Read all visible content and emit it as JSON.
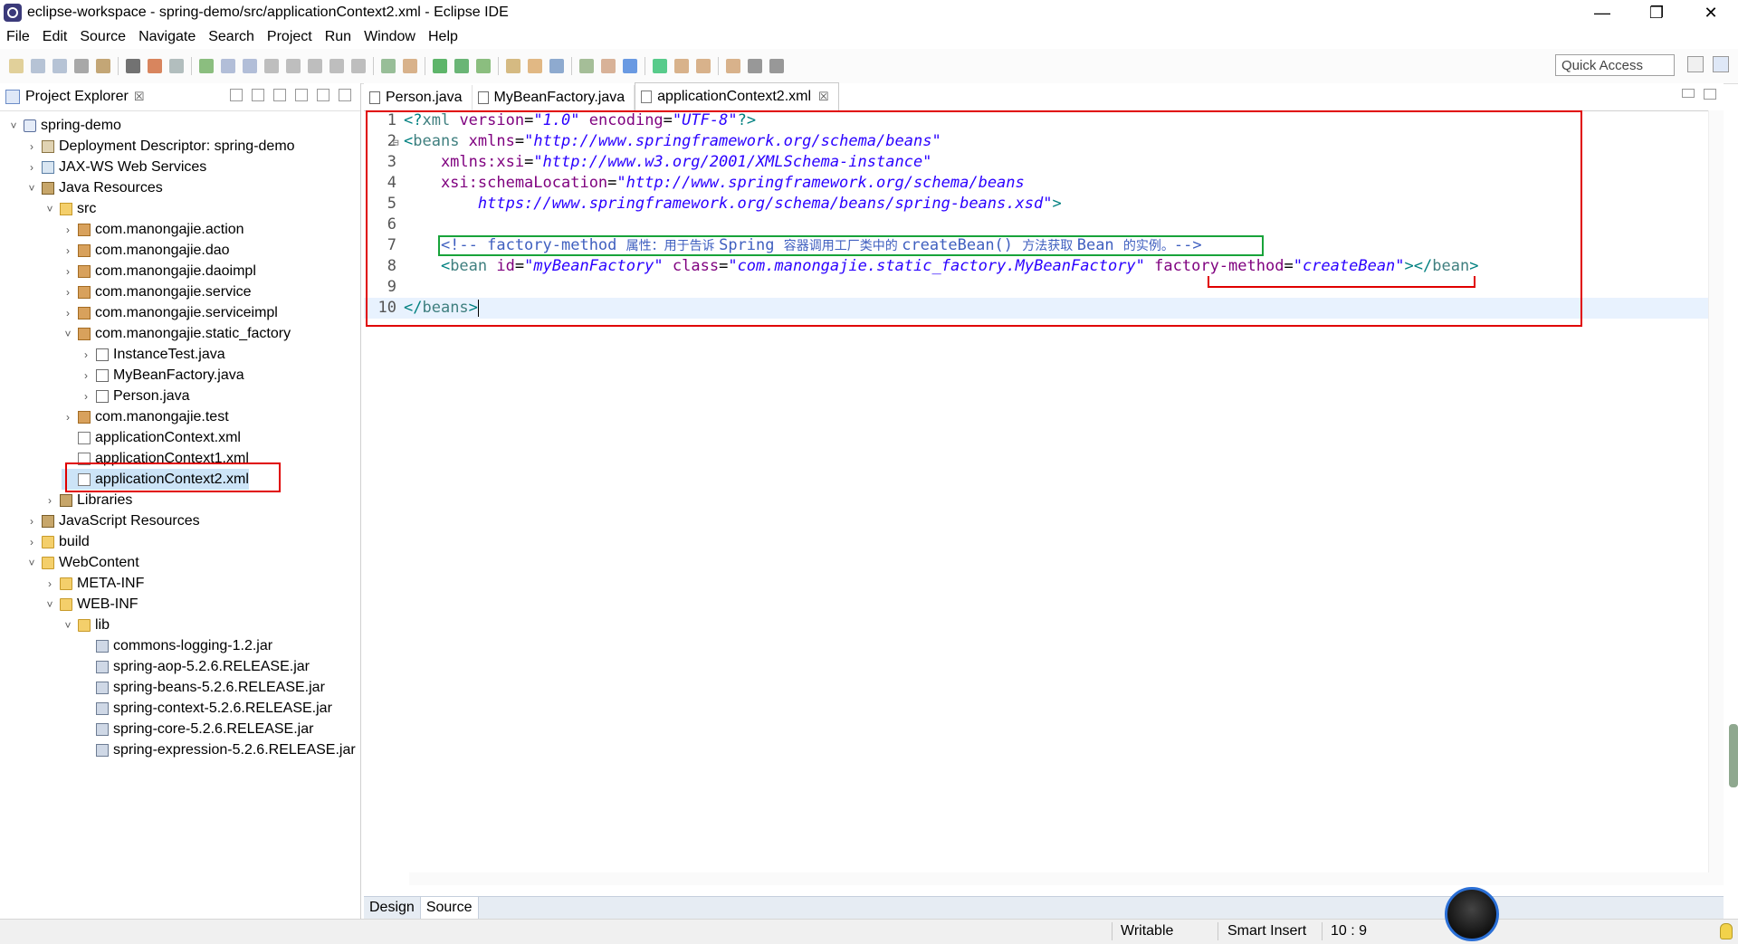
{
  "window": {
    "title": "eclipse-workspace - spring-demo/src/applicationContext2.xml - Eclipse IDE",
    "controls": [
      "—",
      "❐",
      "✕"
    ]
  },
  "menu": [
    "File",
    "Edit",
    "Source",
    "Navigate",
    "Search",
    "Project",
    "Run",
    "Window",
    "Help"
  ],
  "toolbar": {
    "quick_access_placeholder": "Quick Access"
  },
  "explorer": {
    "title": "Project Explorer",
    "close": "☒",
    "items": [
      {
        "label": "spring-demo",
        "arrow": "˅",
        "icon": "project-icon"
      },
      {
        "label": "Deployment Descriptor: spring-demo",
        "arrow": "›",
        "icon": "deployment-descriptor-icon"
      },
      {
        "label": "JAX-WS Web Services",
        "arrow": "›",
        "icon": "web-services-icon"
      },
      {
        "label": "Java Resources",
        "arrow": "˅",
        "icon": "java-resources-icon"
      },
      {
        "label": "src",
        "arrow": "˅",
        "icon": "source-folder-icon"
      },
      {
        "label": "com.manongajie.action",
        "arrow": "›",
        "icon": "package-icon"
      },
      {
        "label": "com.manongajie.dao",
        "arrow": "›",
        "icon": "package-icon"
      },
      {
        "label": "com.manongajie.daoimpl",
        "arrow": "›",
        "icon": "package-icon"
      },
      {
        "label": "com.manongajie.service",
        "arrow": "›",
        "icon": "package-icon"
      },
      {
        "label": "com.manongajie.serviceimpl",
        "arrow": "›",
        "icon": "package-icon"
      },
      {
        "label": "com.manongajie.static_factory",
        "arrow": "˅",
        "icon": "package-icon"
      },
      {
        "label": "InstanceTest.java",
        "arrow": "›",
        "icon": "java-file-icon"
      },
      {
        "label": "MyBeanFactory.java",
        "arrow": "›",
        "icon": "java-file-icon"
      },
      {
        "label": "Person.java",
        "arrow": "›",
        "icon": "java-file-icon"
      },
      {
        "label": "com.manongajie.test",
        "arrow": "›",
        "icon": "package-icon"
      },
      {
        "label": "applicationContext.xml",
        "arrow": "",
        "icon": "xml-file-icon"
      },
      {
        "label": "applicationContext1.xml",
        "arrow": "",
        "icon": "xml-file-icon"
      },
      {
        "label": "applicationContext2.xml",
        "arrow": "",
        "icon": "xml-file-icon"
      },
      {
        "label": "Libraries",
        "arrow": "›",
        "icon": "libraries-icon"
      },
      {
        "label": "JavaScript Resources",
        "arrow": "›",
        "icon": "javascript-resources-icon"
      },
      {
        "label": "build",
        "arrow": "›",
        "icon": "folder-icon"
      },
      {
        "label": "WebContent",
        "arrow": "˅",
        "icon": "folder-icon"
      },
      {
        "label": "META-INF",
        "arrow": "›",
        "icon": "folder-icon"
      },
      {
        "label": "WEB-INF",
        "arrow": "˅",
        "icon": "folder-icon"
      },
      {
        "label": "lib",
        "arrow": "˅",
        "icon": "folder-icon"
      },
      {
        "label": "commons-logging-1.2.jar",
        "arrow": "",
        "icon": "jar-icon"
      },
      {
        "label": "spring-aop-5.2.6.RELEASE.jar",
        "arrow": "",
        "icon": "jar-icon"
      },
      {
        "label": "spring-beans-5.2.6.RELEASE.jar",
        "arrow": "",
        "icon": "jar-icon"
      },
      {
        "label": "spring-context-5.2.6.RELEASE.jar",
        "arrow": "",
        "icon": "jar-icon"
      },
      {
        "label": "spring-core-5.2.6.RELEASE.jar",
        "arrow": "",
        "icon": "jar-icon"
      },
      {
        "label": "spring-expression-5.2.6.RELEASE.jar",
        "arrow": "",
        "icon": "jar-icon"
      }
    ]
  },
  "editor": {
    "tabs": [
      {
        "label": "Person.java",
        "icon": "java-file-icon"
      },
      {
        "label": "MyBeanFactory.java",
        "icon": "java-file-icon"
      },
      {
        "label": "applicationContext2.xml",
        "icon": "xml-file-icon",
        "close": "☒"
      }
    ],
    "lines": [
      {
        "num": "1",
        "marker": "",
        "tokens": [
          {
            "t": "<?",
            "c": "t-punct"
          },
          {
            "t": "xml ",
            "c": "t-tag"
          },
          {
            "t": "version",
            "c": "t-attr"
          },
          {
            "t": "=",
            "c": ""
          },
          {
            "t": "\"1.0\"",
            "c": "t-val"
          },
          {
            "t": " ",
            "c": ""
          },
          {
            "t": "encoding",
            "c": "t-attr"
          },
          {
            "t": "=",
            "c": ""
          },
          {
            "t": "\"UTF-8\"",
            "c": "t-val"
          },
          {
            "t": "?>",
            "c": "t-punct"
          }
        ]
      },
      {
        "num": "2",
        "marker": "⊟",
        "tokens": [
          {
            "t": "<",
            "c": "t-punct"
          },
          {
            "t": "beans ",
            "c": "t-tag"
          },
          {
            "t": "xmlns",
            "c": "t-attr"
          },
          {
            "t": "=",
            "c": ""
          },
          {
            "t": "\"http://www.springframework.org/schema/beans\"",
            "c": "t-val"
          }
        ]
      },
      {
        "num": "3",
        "marker": "",
        "tokens": [
          {
            "t": "    xmlns:xsi",
            "c": "t-attr"
          },
          {
            "t": "=",
            "c": ""
          },
          {
            "t": "\"http://www.w3.org/2001/XMLSchema-instance\"",
            "c": "t-val"
          }
        ]
      },
      {
        "num": "4",
        "marker": "",
        "tokens": [
          {
            "t": "    xsi:schemaLocation",
            "c": "t-attr"
          },
          {
            "t": "=",
            "c": ""
          },
          {
            "t": "\"http://www.springframework.org/schema/beans",
            "c": "t-val"
          }
        ]
      },
      {
        "num": "5",
        "marker": "",
        "tokens": [
          {
            "t": "        https://www.springframework.org/schema/beans/spring-beans.xsd\"",
            "c": "t-val"
          },
          {
            "t": ">",
            "c": "t-punct"
          }
        ]
      },
      {
        "num": "6",
        "marker": "",
        "tokens": []
      },
      {
        "num": "7",
        "marker": "",
        "tokens": [
          {
            "t": "    <!-- factory-method ",
            "c": "t-comment"
          },
          {
            "t": "属性：用于告诉 ",
            "c": "t-comment zh"
          },
          {
            "t": "Spring ",
            "c": "t-comment"
          },
          {
            "t": "容器调用工厂类中的 ",
            "c": "t-comment zh"
          },
          {
            "t": "createBean() ",
            "c": "t-comment"
          },
          {
            "t": "方法获取 ",
            "c": "t-comment zh"
          },
          {
            "t": "Bean ",
            "c": "t-comment"
          },
          {
            "t": "的实例。",
            "c": "t-comment zh"
          },
          {
            "t": "-->",
            "c": "t-comment"
          }
        ]
      },
      {
        "num": "8",
        "marker": "",
        "tokens": [
          {
            "t": "    <",
            "c": "t-punct"
          },
          {
            "t": "bean ",
            "c": "t-tag"
          },
          {
            "t": "id",
            "c": "t-attr"
          },
          {
            "t": "=",
            "c": ""
          },
          {
            "t": "\"myBeanFactory\"",
            "c": "t-val"
          },
          {
            "t": " ",
            "c": ""
          },
          {
            "t": "class",
            "c": "t-attr"
          },
          {
            "t": "=",
            "c": ""
          },
          {
            "t": "\"com.manongajie.static_factory.MyBeanFactory\"",
            "c": "t-val"
          },
          {
            "t": " ",
            "c": ""
          },
          {
            "t": "factory-method",
            "c": "t-attr"
          },
          {
            "t": "=",
            "c": ""
          },
          {
            "t": "\"createBean\"",
            "c": "t-val"
          },
          {
            "t": "></",
            "c": "t-punct"
          },
          {
            "t": "bean",
            "c": "t-tag"
          },
          {
            "t": ">",
            "c": "t-punct"
          }
        ]
      },
      {
        "num": "9",
        "marker": "",
        "tokens": []
      },
      {
        "num": "10",
        "marker": "",
        "tokens": [
          {
            "t": "</",
            "c": "t-punct"
          },
          {
            "t": "beans",
            "c": "t-tag"
          },
          {
            "t": ">",
            "c": "t-punct"
          }
        ]
      }
    ],
    "bottom_tabs": [
      "Design",
      "Source"
    ]
  },
  "status": {
    "writable": "Writable",
    "insert_mode": "Smart Insert",
    "position": "10 : 9"
  },
  "colors": {
    "annotation_red": "#e00000",
    "annotation_green": "#18a33a",
    "xml_value": "#2a00ff",
    "xml_attr": "#7f007f",
    "xml_tag": "#3f7f7f",
    "xml_comment": "#3f5fbf"
  }
}
